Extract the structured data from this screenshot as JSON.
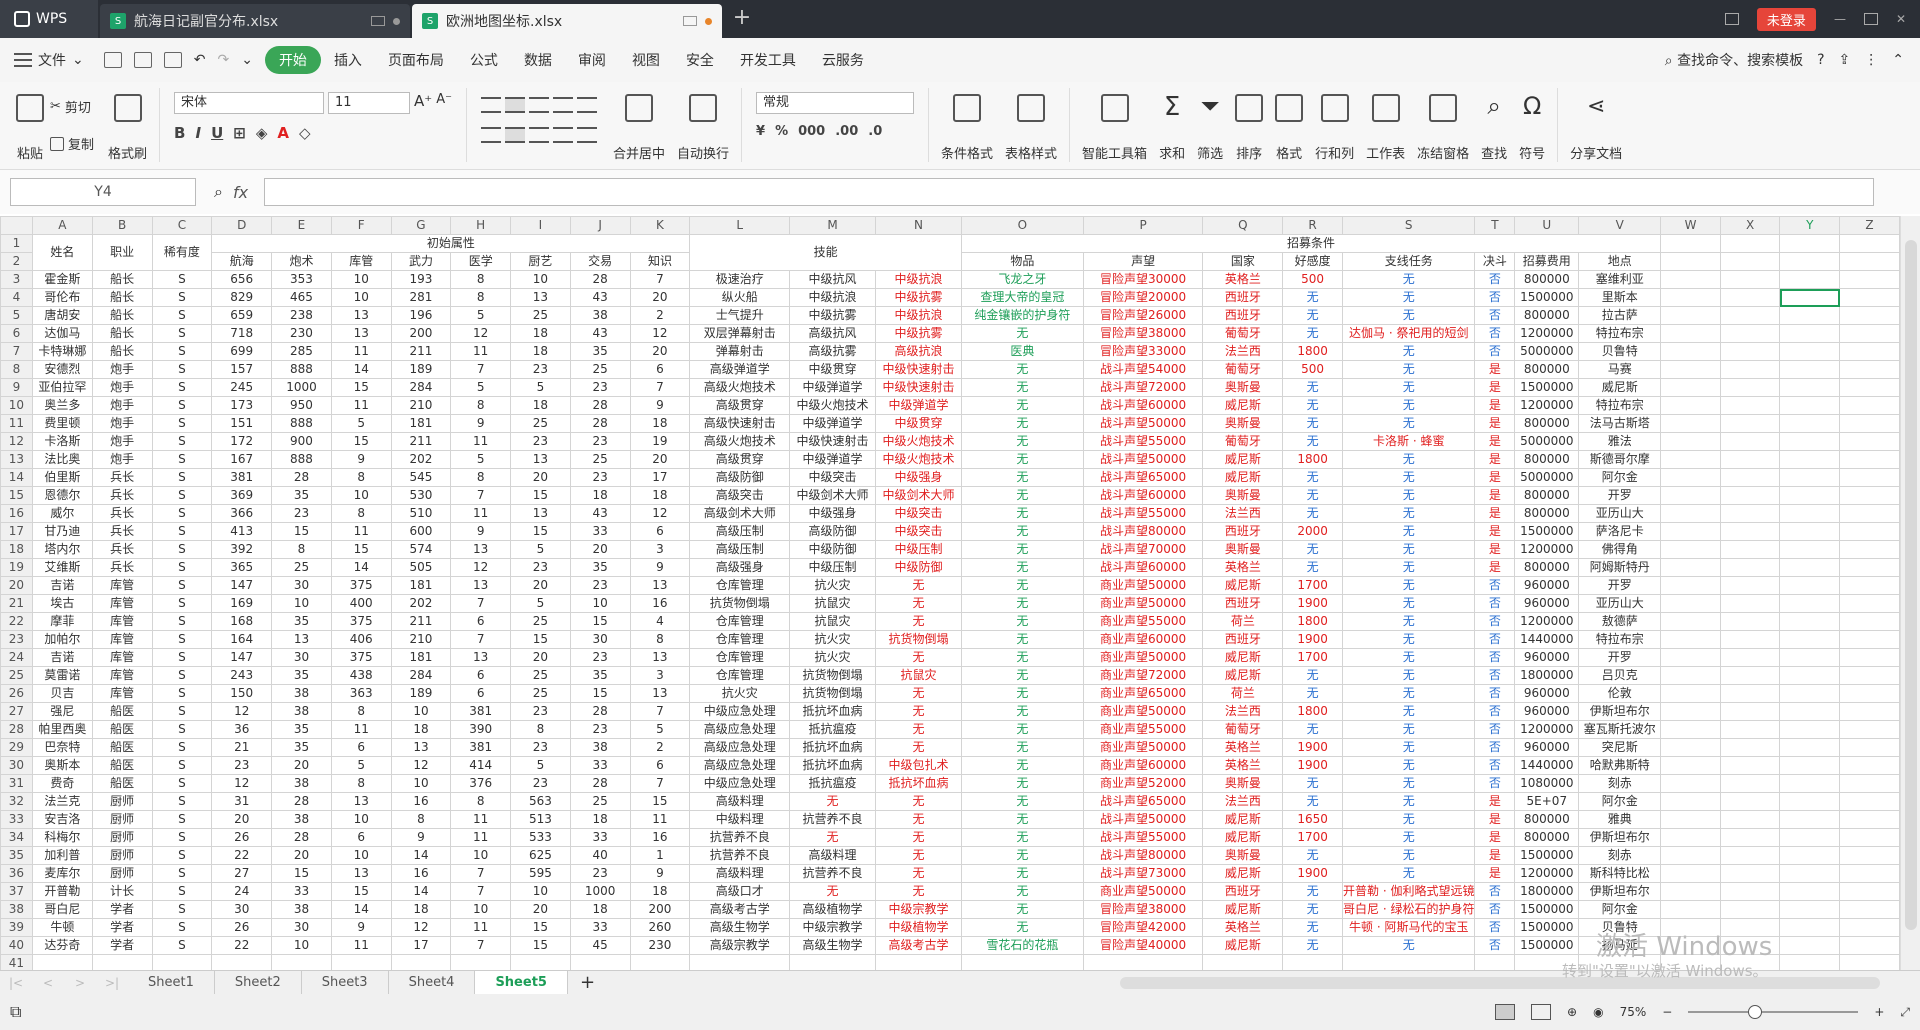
{
  "titlebar": {
    "app": "WPS",
    "tabs": [
      "航海日记副官分布.xlsx",
      "欧洲地图坐标.xlsx"
    ],
    "login": "未登录"
  },
  "menu": {
    "file": "文件",
    "items": [
      "开始",
      "插入",
      "页面布局",
      "公式",
      "数据",
      "审阅",
      "视图",
      "安全",
      "开发工具",
      "云服务"
    ],
    "search": "查找命令、搜索模板"
  },
  "ribbon": {
    "paste": "粘贴",
    "cut": "剪切",
    "copy": "复制",
    "format_painter": "格式刷",
    "font": "宋体",
    "size": "11",
    "numfmt": "常规",
    "merge": "合并居中",
    "wrap": "自动换行",
    "cond": "条件格式",
    "table_style": "表格样式",
    "toolbox": "智能工具箱",
    "sum": "求和",
    "filter": "筛选",
    "sort": "排序",
    "format": "格式",
    "rowcol": "行和列",
    "sheet": "工作表",
    "freeze": "冻结窗格",
    "find": "查找",
    "symbol": "符号",
    "share": "分享文档"
  },
  "namebox": "Y4",
  "columns": [
    "A",
    "B",
    "C",
    "D",
    "E",
    "F",
    "G",
    "H",
    "I",
    "J",
    "K",
    "L",
    "M",
    "N",
    "O",
    "P",
    "Q",
    "R",
    "S",
    "T",
    "U",
    "V",
    "W",
    "X",
    "Y",
    "Z"
  ],
  "header1": {
    "attr": "初始属性",
    "skill": "技能",
    "recruit": "招募条件"
  },
  "header2": [
    "姓名",
    "职业",
    "稀有度",
    "航海",
    "炮术",
    "库管",
    "武力",
    "医学",
    "厨艺",
    "交易",
    "知识",
    "物品",
    "声望",
    "国家",
    "好感度",
    "支线任务",
    "决斗",
    "招募费用",
    "地点"
  ],
  "rows": [
    [
      "霍金斯",
      "船长",
      "S",
      "656",
      "353",
      "10",
      "193",
      "8",
      "10",
      "28",
      "7",
      "极速治疗",
      "中级抗风",
      "中级抗浪",
      "飞龙之牙",
      "冒险声望30000",
      "英格兰",
      "500",
      "无",
      "否",
      "800000",
      "塞维利亚"
    ],
    [
      "哥伦布",
      "船长",
      "S",
      "829",
      "465",
      "10",
      "281",
      "8",
      "13",
      "43",
      "20",
      "纵火船",
      "中级抗浪",
      "中级抗雾",
      "查理大帝的皇冠",
      "冒险声望20000",
      "西班牙",
      "无",
      "无",
      "否",
      "1500000",
      "里斯本"
    ],
    [
      "唐胡安",
      "船长",
      "S",
      "659",
      "238",
      "13",
      "196",
      "5",
      "25",
      "38",
      "2",
      "士气提升",
      "中级抗雾",
      "中级抗浪",
      "纯金镶嵌的护身符",
      "冒险声望26000",
      "西班牙",
      "无",
      "无",
      "否",
      "800000",
      "拉古萨"
    ],
    [
      "达伽马",
      "船长",
      "S",
      "718",
      "230",
      "13",
      "200",
      "12",
      "18",
      "43",
      "12",
      "双层弹幕射击",
      "高级抗风",
      "中级抗雾",
      "无",
      "冒险声望38000",
      "葡萄牙",
      "无",
      "达伽马 · 祭祀用的短剑",
      "否",
      "1200000",
      "特拉布宗"
    ],
    [
      "卡特琳娜",
      "船长",
      "S",
      "699",
      "285",
      "11",
      "211",
      "11",
      "18",
      "35",
      "20",
      "弹幕射击",
      "高级抗雾",
      "高级抗浪",
      "医典",
      "冒险声望33000",
      "法兰西",
      "1800",
      "无",
      "否",
      "5000000",
      "贝鲁特"
    ],
    [
      "安德烈",
      "炮手",
      "S",
      "157",
      "888",
      "14",
      "189",
      "7",
      "23",
      "25",
      "6",
      "高级弹道学",
      "中级贯穿",
      "中级快速射击",
      "无",
      "战斗声望54000",
      "葡萄牙",
      "500",
      "无",
      "是",
      "800000",
      "马赛"
    ],
    [
      "亚伯拉罕",
      "炮手",
      "S",
      "245",
      "1000",
      "15",
      "284",
      "5",
      "5",
      "23",
      "7",
      "高级火炮技术",
      "中级弹道学",
      "中级快速射击",
      "无",
      "战斗声望72000",
      "奥斯曼",
      "无",
      "无",
      "是",
      "1500000",
      "威尼斯"
    ],
    [
      "奥兰多",
      "炮手",
      "S",
      "173",
      "950",
      "11",
      "210",
      "8",
      "18",
      "28",
      "9",
      "高级贯穿",
      "中级火炮技术",
      "中级弹道学",
      "无",
      "战斗声望60000",
      "威尼斯",
      "无",
      "无",
      "是",
      "1200000",
      "特拉布宗"
    ],
    [
      "费里顿",
      "炮手",
      "S",
      "151",
      "888",
      "5",
      "181",
      "9",
      "25",
      "28",
      "18",
      "高级快速射击",
      "中级弹道学",
      "中级贯穿",
      "无",
      "战斗声望50000",
      "奥斯曼",
      "无",
      "无",
      "是",
      "800000",
      "法马古斯塔"
    ],
    [
      "卡洛斯",
      "炮手",
      "S",
      "172",
      "900",
      "15",
      "211",
      "11",
      "23",
      "23",
      "19",
      "高级火炮技术",
      "中级快速射击",
      "中级火炮技术",
      "无",
      "战斗声望55000",
      "葡萄牙",
      "无",
      "卡洛斯 · 蜂蜜",
      "是",
      "5000000",
      "雅法"
    ],
    [
      "法比奥",
      "炮手",
      "S",
      "167",
      "888",
      "9",
      "202",
      "5",
      "13",
      "25",
      "20",
      "高级贯穿",
      "中级弹道学",
      "中级火炮技术",
      "无",
      "战斗声望50000",
      "威尼斯",
      "1800",
      "无",
      "是",
      "800000",
      "斯德哥尔摩"
    ],
    [
      "伯里斯",
      "兵长",
      "S",
      "381",
      "28",
      "8",
      "545",
      "8",
      "20",
      "23",
      "17",
      "高级防御",
      "中级突击",
      "中级强身",
      "无",
      "战斗声望65000",
      "威尼斯",
      "无",
      "无",
      "是",
      "5000000",
      "阿尔金"
    ],
    [
      "恩德尔",
      "兵长",
      "S",
      "369",
      "35",
      "10",
      "530",
      "7",
      "15",
      "18",
      "18",
      "高级突击",
      "中级剑术大师",
      "中级剑术大师",
      "无",
      "战斗声望60000",
      "奥斯曼",
      "无",
      "无",
      "是",
      "800000",
      "开罗"
    ],
    [
      "威尔",
      "兵长",
      "S",
      "366",
      "23",
      "8",
      "510",
      "11",
      "13",
      "43",
      "12",
      "高级剑术大师",
      "中级强身",
      "中级突击",
      "无",
      "战斗声望55000",
      "法兰西",
      "无",
      "无",
      "是",
      "800000",
      "亚历山大"
    ],
    [
      "甘乃迪",
      "兵长",
      "S",
      "413",
      "15",
      "11",
      "600",
      "9",
      "15",
      "33",
      "6",
      "高级压制",
      "高级防御",
      "中级突击",
      "无",
      "战斗声望80000",
      "西班牙",
      "2000",
      "无",
      "是",
      "1500000",
      "萨洛尼卡"
    ],
    [
      "塔内尔",
      "兵长",
      "S",
      "392",
      "8",
      "15",
      "574",
      "13",
      "5",
      "20",
      "3",
      "高级压制",
      "中级防御",
      "中级压制",
      "无",
      "战斗声望70000",
      "奥斯曼",
      "无",
      "无",
      "是",
      "1200000",
      "佛得角"
    ],
    [
      "艾维斯",
      "兵长",
      "S",
      "365",
      "25",
      "14",
      "505",
      "12",
      "23",
      "35",
      "9",
      "高级强身",
      "中级压制",
      "中级防御",
      "无",
      "战斗声望60000",
      "英格兰",
      "无",
      "无",
      "是",
      "800000",
      "阿姆斯特丹"
    ],
    [
      "吉诺",
      "库管",
      "S",
      "147",
      "30",
      "375",
      "181",
      "13",
      "20",
      "23",
      "13",
      "仓库管理",
      "抗火灾",
      "无",
      "无",
      "商业声望50000",
      "威尼斯",
      "1700",
      "无",
      "否",
      "960000",
      "开罗"
    ],
    [
      "埃古",
      "库管",
      "S",
      "169",
      "10",
      "400",
      "202",
      "7",
      "5",
      "10",
      "16",
      "抗货物倒塌",
      "抗鼠灾",
      "无",
      "无",
      "商业声望50000",
      "西班牙",
      "1900",
      "无",
      "否",
      "960000",
      "亚历山大"
    ],
    [
      "摩菲",
      "库管",
      "S",
      "168",
      "35",
      "375",
      "211",
      "6",
      "25",
      "15",
      "4",
      "仓库管理",
      "抗鼠灾",
      "无",
      "无",
      "商业声望55000",
      "荷兰",
      "1800",
      "无",
      "否",
      "1200000",
      "敖德萨"
    ],
    [
      "加帕尔",
      "库管",
      "S",
      "164",
      "13",
      "406",
      "210",
      "7",
      "15",
      "30",
      "8",
      "仓库管理",
      "抗火灾",
      "抗货物倒塌",
      "无",
      "商业声望60000",
      "西班牙",
      "1900",
      "无",
      "否",
      "1440000",
      "特拉布宗"
    ],
    [
      "吉诺",
      "库管",
      "S",
      "147",
      "30",
      "375",
      "181",
      "13",
      "20",
      "23",
      "13",
      "仓库管理",
      "抗火灾",
      "无",
      "无",
      "商业声望50000",
      "威尼斯",
      "1700",
      "无",
      "否",
      "960000",
      "开罗"
    ],
    [
      "莫雷诺",
      "库管",
      "S",
      "243",
      "35",
      "438",
      "284",
      "6",
      "25",
      "35",
      "3",
      "仓库管理",
      "抗货物倒塌",
      "抗鼠灾",
      "无",
      "商业声望72000",
      "威尼斯",
      "无",
      "无",
      "否",
      "1800000",
      "吕贝克"
    ],
    [
      "贝吉",
      "库管",
      "S",
      "150",
      "38",
      "363",
      "189",
      "6",
      "25",
      "15",
      "13",
      "抗火灾",
      "抗货物倒塌",
      "无",
      "无",
      "商业声望65000",
      "荷兰",
      "无",
      "无",
      "否",
      "960000",
      "伦敦"
    ],
    [
      "强尼",
      "船医",
      "S",
      "12",
      "38",
      "8",
      "10",
      "381",
      "23",
      "28",
      "7",
      "中级应急处理",
      "抵抗坏血病",
      "无",
      "无",
      "商业声望50000",
      "法兰西",
      "1800",
      "无",
      "否",
      "960000",
      "伊斯坦布尔"
    ],
    [
      "帕里西奥",
      "船医",
      "S",
      "36",
      "35",
      "11",
      "18",
      "390",
      "8",
      "23",
      "5",
      "高级应急处理",
      "抵抗瘟疫",
      "无",
      "无",
      "商业声望55000",
      "葡萄牙",
      "无",
      "无",
      "否",
      "1200000",
      "塞瓦斯托波尔"
    ],
    [
      "巴奈特",
      "船医",
      "S",
      "21",
      "35",
      "6",
      "13",
      "381",
      "23",
      "38",
      "2",
      "高级应急处理",
      "抵抗坏血病",
      "无",
      "无",
      "商业声望50000",
      "英格兰",
      "1900",
      "无",
      "否",
      "960000",
      "突尼斯"
    ],
    [
      "奥斯本",
      "船医",
      "S",
      "23",
      "20",
      "5",
      "12",
      "414",
      "5",
      "33",
      "6",
      "高级应急处理",
      "抵抗坏血病",
      "中级包扎术",
      "无",
      "商业声望60000",
      "英格兰",
      "1900",
      "无",
      "否",
      "1440000",
      "哈默弗斯特"
    ],
    [
      "费奇",
      "船医",
      "S",
      "12",
      "38",
      "8",
      "10",
      "376",
      "23",
      "28",
      "7",
      "中级应急处理",
      "抵抗瘟疫",
      "抵抗坏血病",
      "无",
      "商业声望52000",
      "奥斯曼",
      "无",
      "无",
      "否",
      "1080000",
      "刻赤"
    ],
    [
      "法兰克",
      "厨师",
      "S",
      "31",
      "28",
      "13",
      "16",
      "8",
      "563",
      "25",
      "15",
      "高级料理",
      "无",
      "无",
      "无",
      "战斗声望65000",
      "法兰西",
      "无",
      "无",
      "是",
      "5E+07",
      "阿尔金"
    ],
    [
      "安吉洛",
      "厨师",
      "S",
      "20",
      "38",
      "10",
      "8",
      "11",
      "513",
      "18",
      "11",
      "中级料理",
      "抗营养不良",
      "无",
      "无",
      "战斗声望50000",
      "威尼斯",
      "1650",
      "无",
      "是",
      "800000",
      "雅典"
    ],
    [
      "科梅尔",
      "厨师",
      "S",
      "26",
      "28",
      "6",
      "9",
      "11",
      "533",
      "33",
      "16",
      "抗营养不良",
      "无",
      "无",
      "无",
      "战斗声望55000",
      "威尼斯",
      "1700",
      "无",
      "是",
      "800000",
      "伊斯坦布尔"
    ],
    [
      "加利普",
      "厨师",
      "S",
      "22",
      "20",
      "10",
      "14",
      "10",
      "625",
      "40",
      "1",
      "抗营养不良",
      "高级料理",
      "无",
      "无",
      "战斗声望80000",
      "奥斯曼",
      "无",
      "无",
      "是",
      "1500000",
      "刻赤"
    ],
    [
      "麦库尔",
      "厨师",
      "S",
      "27",
      "15",
      "13",
      "16",
      "7",
      "595",
      "23",
      "9",
      "高级料理",
      "抗营养不良",
      "无",
      "无",
      "战斗声望73000",
      "威尼斯",
      "1900",
      "无",
      "是",
      "1200000",
      "斯科特比松"
    ],
    [
      "开普勒",
      "计长",
      "S",
      "24",
      "33",
      "15",
      "14",
      "7",
      "10",
      "1000",
      "18",
      "高级口才",
      "无",
      "无",
      "无",
      "商业声望50000",
      "西班牙",
      "无",
      "开普勒 · 伽利略式望远镜",
      "否",
      "1800000",
      "伊斯坦布尔"
    ],
    [
      "哥白尼",
      "学者",
      "S",
      "30",
      "38",
      "14",
      "18",
      "10",
      "20",
      "18",
      "200",
      "高级考古学",
      "高级植物学",
      "中级宗教学",
      "无",
      "冒险声望38000",
      "威尼斯",
      "无",
      "哥白尼 · 绿松石的护身符",
      "否",
      "1500000",
      "阿尔金"
    ],
    [
      "牛顿",
      "学者",
      "S",
      "26",
      "30",
      "9",
      "12",
      "11",
      "15",
      "33",
      "260",
      "高级生物学",
      "中级宗教学",
      "中级植物学",
      "无",
      "冒险声望42000",
      "英格兰",
      "无",
      "牛顿 · 阿斯马代的宝玉",
      "否",
      "1500000",
      "贝鲁特"
    ],
    [
      "达芬奇",
      "学者",
      "S",
      "22",
      "10",
      "11",
      "17",
      "7",
      "15",
      "45",
      "230",
      "高级宗教学",
      "高级生物学",
      "高级考古学",
      "雪花石的花瓶",
      "冒险声望40000",
      "威尼斯",
      "无",
      "无",
      "否",
      "1500000",
      "扬马延"
    ]
  ],
  "sheets": [
    "Sheet1",
    "Sheet2",
    "Sheet3",
    "Sheet4",
    "Sheet5"
  ],
  "status": {
    "zoom": "75%"
  },
  "watermark": {
    "line1": "激活 Windows",
    "line2": "转到\"设置\"以激活 Windows。"
  }
}
